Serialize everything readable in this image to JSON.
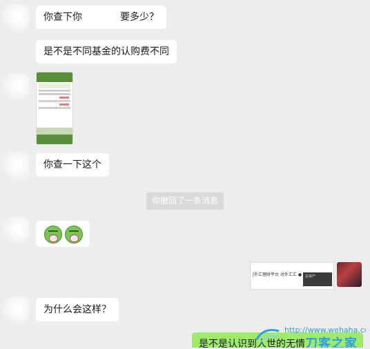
{
  "messages": {
    "m1_before": "你查下你",
    "m1_after": "要多少？",
    "m2": "是不是不同基金的认购费不同",
    "m3": "你查一下这个",
    "m4": "为什么会这样？",
    "m5_partial": "是不是认识到人世的无情"
  },
  "system_notice": "你撤回了一条消息",
  "shared_card": {
    "snippet": "ʃ外汇理财平台 对外汇汇 ● 外 ○ 外",
    "dark_label": "总资产"
  },
  "self_avatar_text": "",
  "watermark": {
    "url": "http://www.wehaha.com",
    "brand": "刀客之家"
  },
  "colors": {
    "background": "#ededed",
    "incoming_bubble": "#ffffff",
    "outgoing_bubble": "#9eea6a",
    "watermark_blue": "#2e9ee6"
  },
  "icons": [
    "blurred-avatar",
    "crying-emoji"
  ]
}
